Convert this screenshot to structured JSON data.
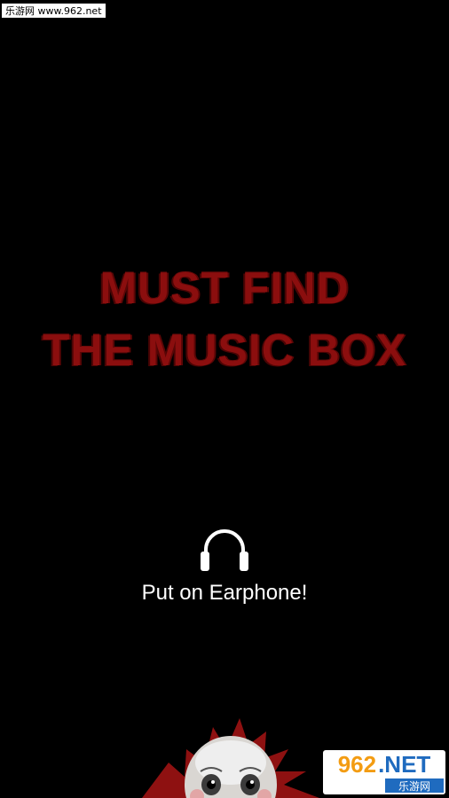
{
  "watermark_top": "乐游网 www.962.net",
  "title": {
    "line1": "MUST FIND",
    "line2": "THE MUSIC BOX"
  },
  "earphone": {
    "icon": "headphones-icon",
    "label": "Put on Earphone!"
  },
  "logo": {
    "number": "962",
    "suffix": ".NET",
    "caption": "乐游网"
  },
  "colors": {
    "background": "#000000",
    "title_red": "#8b0e0e",
    "text": "#ffffff"
  }
}
